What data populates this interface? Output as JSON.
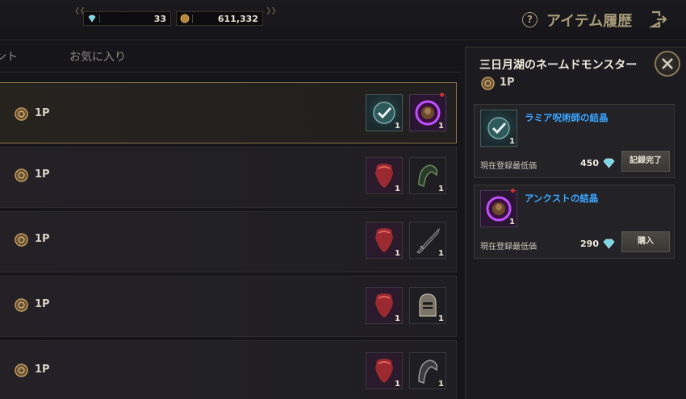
{
  "currency": {
    "diamonds": "33",
    "gold": "611,332"
  },
  "header": {
    "help_icon": "?",
    "title": "アイテム履歴",
    "exit_icon": "exit-icon"
  },
  "tabs": [
    {
      "label": "ント"
    },
    {
      "label": "お気に入り"
    }
  ],
  "rows": [
    {
      "points": "1P",
      "items": [
        {
          "icon": "check-icon",
          "count": "1"
        },
        {
          "icon": "purple-orb-icon",
          "count": "1",
          "new": true
        }
      ],
      "selected": true
    },
    {
      "points": "1P",
      "items": [
        {
          "icon": "red-armor-icon",
          "count": "1"
        },
        {
          "icon": "green-helm-icon",
          "count": "1"
        }
      ]
    },
    {
      "points": "1P",
      "items": [
        {
          "icon": "red-armor-icon",
          "count": "1"
        },
        {
          "icon": "dark-sword-icon",
          "count": "1"
        }
      ]
    },
    {
      "points": "1P",
      "items": [
        {
          "icon": "red-armor-icon",
          "count": "1"
        },
        {
          "icon": "knight-helm-icon",
          "count": "1"
        }
      ]
    },
    {
      "points": "1P",
      "items": [
        {
          "icon": "red-armor-icon",
          "count": "1"
        },
        {
          "icon": "grey-helm-icon",
          "count": "1"
        }
      ]
    }
  ],
  "panel": {
    "title": "三日月湖のネームドモンスター",
    "points": "1P",
    "cards": [
      {
        "name": "ラミア呪術師の結晶",
        "count": "1",
        "price_label": "現在登録最低価",
        "price": "450",
        "button": "記録完了"
      },
      {
        "name": "アンクストの結晶",
        "count": "1",
        "price_label": "現在登録最低価",
        "price": "290",
        "button": "購入"
      }
    ]
  },
  "colors": {
    "accent_gold": "#a79a78",
    "item_name_blue": "#3aa6ff",
    "selected_border": "#8a7448"
  }
}
